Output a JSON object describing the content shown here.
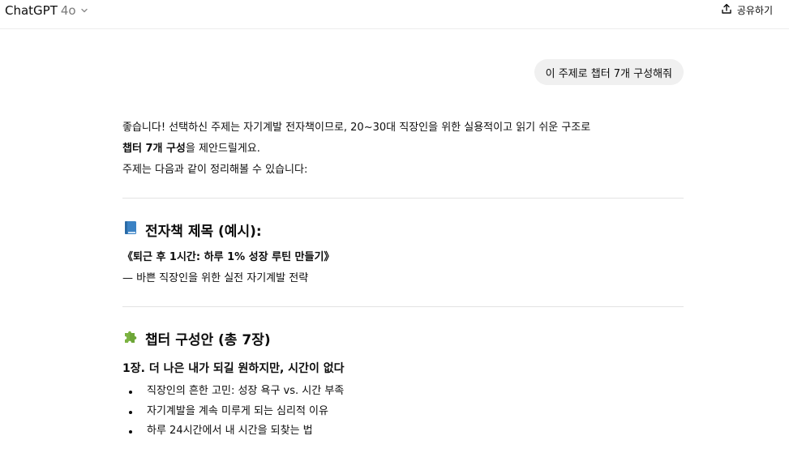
{
  "header": {
    "model_name": "ChatGPT",
    "model_version": "4o",
    "share_label": "공유하기"
  },
  "conversation": {
    "user_message": "이 주제로 챕터 7개 구성해줘",
    "intro_line1": "좋습니다! 선택하신 주제는 자기계발 전자책이므로, 20~30대 직장인을 위한 실용적이고 읽기 쉬운 구조로",
    "intro_line2_bold": "챕터 7개 구성",
    "intro_line2_rest": "을 제안드릴게요.",
    "intro_line3": "주제는 다음과 같이 정리해볼 수 있습니다:",
    "section1": {
      "icon": "book-icon",
      "heading": "전자책 제목 (예시):",
      "title": "《퇴근 후 1시간: 하루 1% 성장 루틴 만들기》",
      "subtitle": "— 바쁜 직장인을 위한 실전 자기계발 전략"
    },
    "section2": {
      "icon": "puzzle-icon",
      "heading": "챕터 구성안 (총 7장)",
      "chapter1": {
        "title": "1장. 더 나은 내가 되길 원하지만, 시간이 없다",
        "items": [
          "직장인의 흔한 고민: 성장 욕구 vs. 시간 부족",
          "자기계발을 계속 미루게 되는 심리적 이유",
          "하루 24시간에서 내 시간을 되찾는 법"
        ]
      }
    }
  },
  "colors": {
    "user_bubble_bg": "#f0f0f0",
    "book_icon": "#3b82c4",
    "puzzle_icon": "#7cb342",
    "divider": "#e3e3e3"
  }
}
